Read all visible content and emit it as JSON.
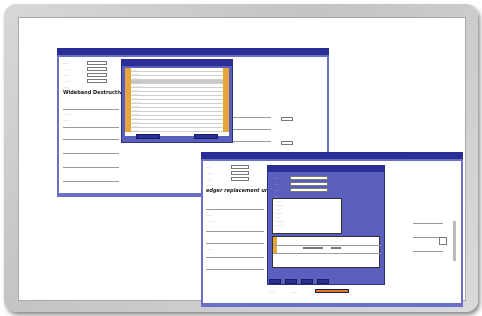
{
  "window1": {
    "heading": "Wideband Destructive Test",
    "titlebar_text": "· · · · · · · · · · · · · · · ·",
    "labels": [
      "·····",
      "·······",
      "······",
      "········",
      "······",
      "·········",
      "·······"
    ],
    "list_items": [
      "······",
      "········",
      "·····",
      "·······",
      "··········",
      "······",
      "········",
      "·····",
      "·········",
      "·······",
      "······",
      "········",
      "·····",
      "·········",
      "·······",
      "······",
      "········",
      "·····",
      "·······",
      "······"
    ],
    "button_left": "·····",
    "button_right": "······"
  },
  "window2": {
    "heading": "edger replacement unit",
    "titlebar_text": "· · · · · · · · · · · · · · · · · · · ·",
    "labels": [
      "·····",
      "·······",
      "······",
      "········",
      "······",
      "·········",
      "·······"
    ],
    "popup_labels": [
      "·····",
      "·····",
      "········",
      "·····"
    ],
    "menu_items": [
      "·······",
      "·········",
      "······",
      "········",
      "·····",
      "·········",
      "········"
    ],
    "footer_checks": [
      "·······",
      "·······",
      "········"
    ],
    "buttons": [
      "···",
      "···",
      "···",
      "···"
    ]
  },
  "colors": {
    "window_bg": "#6b6fc8",
    "titlebar": "#2a2f97",
    "accent": "#e8a53a",
    "warning": "#e07820"
  }
}
